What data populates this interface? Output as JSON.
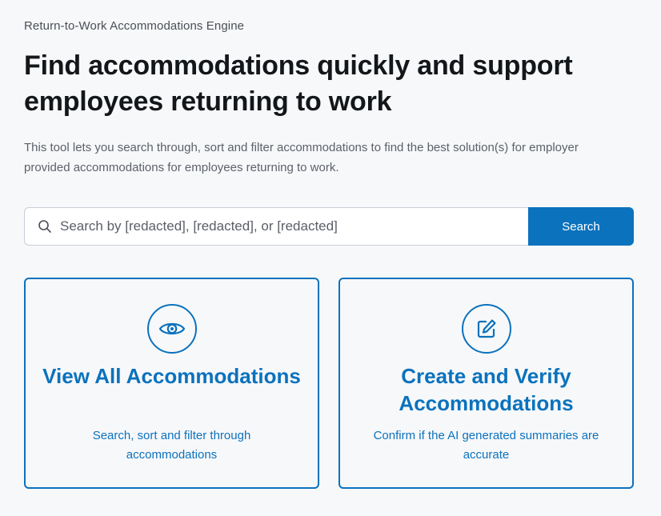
{
  "header": {
    "eyebrow": "Return-to-Work Accommodations Engine",
    "headline": "Find accommodations quickly and support employees returning to work",
    "intro": "This tool lets you search through, sort and filter accommodations to find the best solution(s) for employer provided accommodations for employees returning to work."
  },
  "search": {
    "icon": "search-icon",
    "placeholder": "Search by [redacted], [redacted], or [redacted]",
    "value": "",
    "button_label": "Search"
  },
  "cards": [
    {
      "icon": "eye-icon",
      "title": "View All Accommodations",
      "description": "Search, sort and filter through accommodations"
    },
    {
      "icon": "edit-icon",
      "title": "Create and Verify Accommodations",
      "description": "Confirm if the AI generated summaries are accurate"
    }
  ],
  "colors": {
    "accent": "#0b72bd",
    "background": "#f7f8fa",
    "heading": "#14171a",
    "muted_text": "#5c6169"
  }
}
